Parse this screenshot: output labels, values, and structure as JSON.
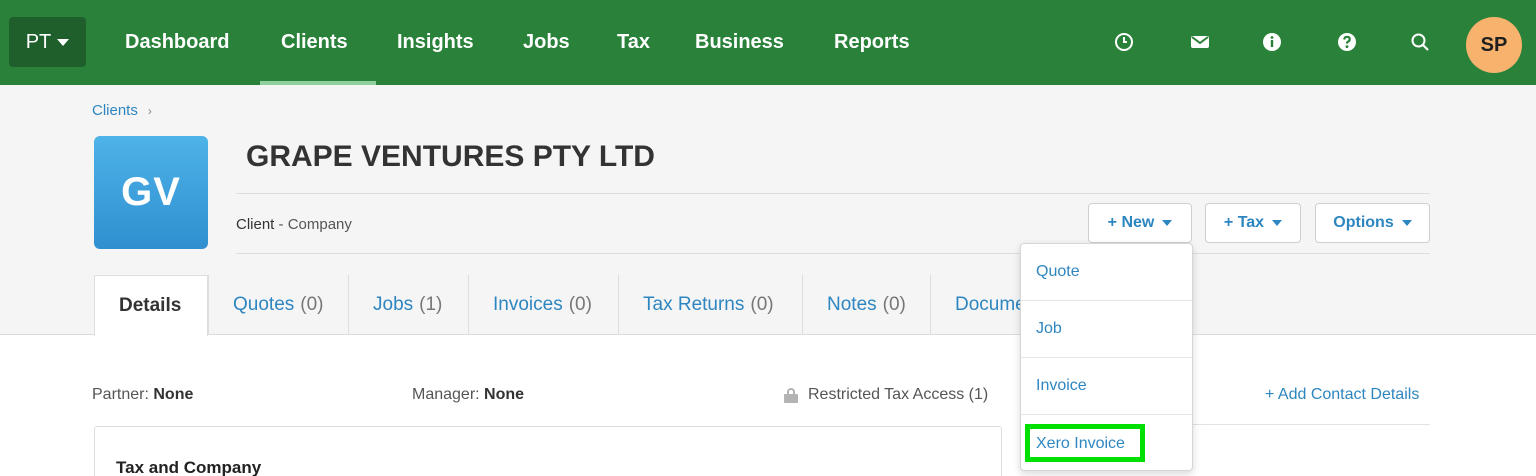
{
  "nav": {
    "org": "PT",
    "items": [
      "Dashboard",
      "Clients",
      "Insights",
      "Jobs",
      "Tax",
      "Business",
      "Reports"
    ],
    "active": "Clients",
    "icons": [
      "clock-icon",
      "mail-icon",
      "info-icon",
      "help-icon",
      "search-icon"
    ],
    "avatar": "SP"
  },
  "breadcrumb": {
    "root": "Clients"
  },
  "client": {
    "initials": "GV",
    "name": "GRAPE VENTURES PTY LTD",
    "type_prefix": "Client",
    "type_sep": " - ",
    "type": "Company"
  },
  "actions": {
    "new": "+ New",
    "tax": "+ Tax",
    "options": "Options"
  },
  "tabs": [
    {
      "label": "Details",
      "count": ""
    },
    {
      "label": "Quotes",
      "count": "(0)"
    },
    {
      "label": "Jobs",
      "count": "(1)"
    },
    {
      "label": "Invoices",
      "count": "(0)"
    },
    {
      "label": "Tax Returns",
      "count": "(0)"
    },
    {
      "label": "Notes",
      "count": "(0)"
    },
    {
      "label": "Docume",
      "count": ""
    }
  ],
  "new_menu": [
    "Quote",
    "Job",
    "Invoice",
    "Xero Invoice"
  ],
  "details": {
    "partner_label": "Partner:",
    "partner_value": "None",
    "manager_label": "Manager:",
    "manager_value": "None",
    "restricted": "Restricted Tax Access (1)",
    "add_contact": "+ Add Contact Details",
    "panel_title": "Tax and Company"
  },
  "colors": {
    "nav_bg": "#2a823a",
    "accent": "#2e86c1",
    "avatar": "#f7b36e",
    "highlight": "#00e000"
  }
}
